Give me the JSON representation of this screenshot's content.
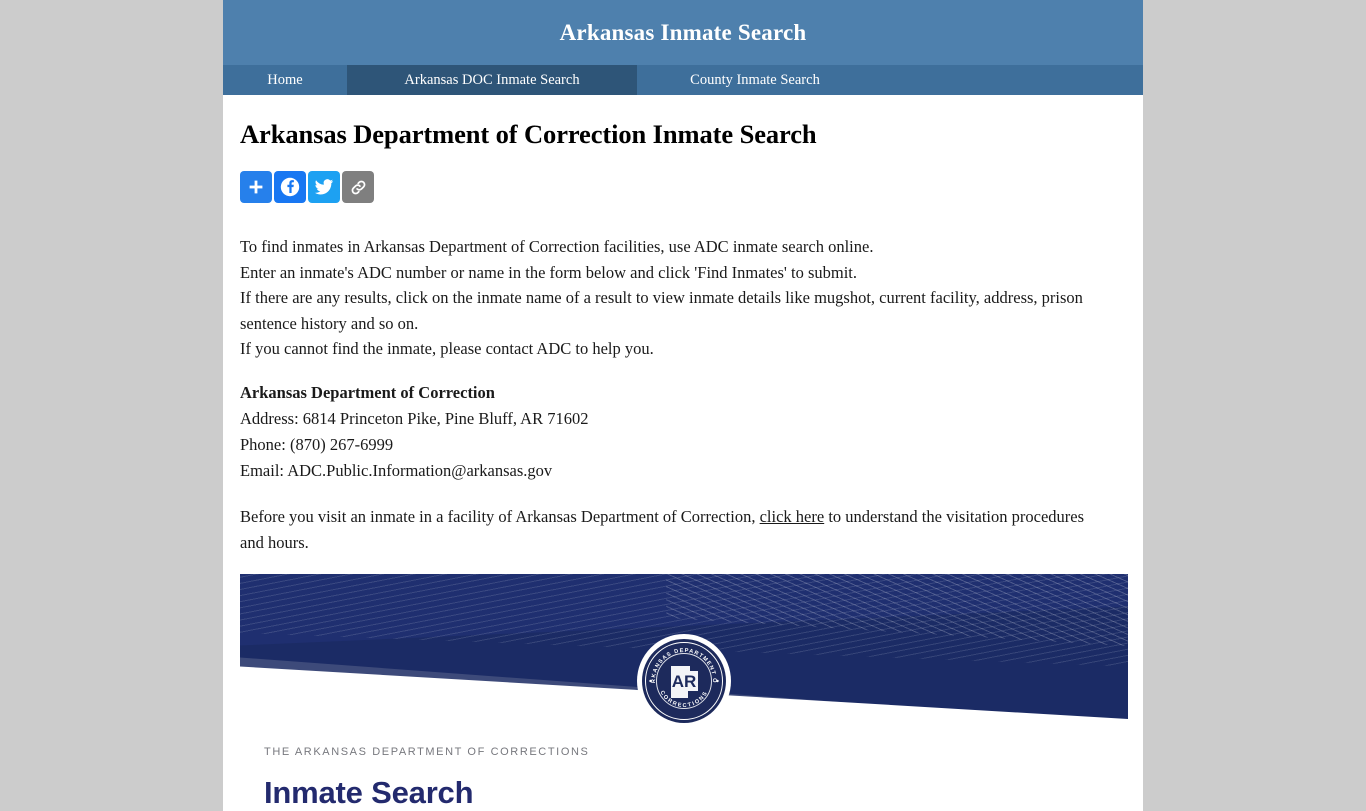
{
  "header": {
    "title": "Arkansas Inmate Search"
  },
  "nav": {
    "items": [
      {
        "label": "Home",
        "active": false
      },
      {
        "label": "Arkansas DOC Inmate Search",
        "active": true
      },
      {
        "label": "County Inmate Search",
        "active": false
      }
    ]
  },
  "main": {
    "page_title": "Arkansas Department of Correction Inmate Search",
    "share": {
      "buttons": [
        {
          "name": "share-plus-icon",
          "label": "Share",
          "color": "#2680eb"
        },
        {
          "name": "facebook-icon",
          "label": "Facebook",
          "color": "#1877f2"
        },
        {
          "name": "twitter-icon",
          "label": "Twitter",
          "color": "#1da1f2"
        },
        {
          "name": "copy-link-icon",
          "label": "Copy Link",
          "color": "#7f7f7f"
        }
      ]
    },
    "intro": {
      "line1": "To find inmates in Arkansas Department of Correction facilities, use ADC inmate search online.",
      "line2": "Enter an inmate's ADC number or name in the form below and click 'Find Inmates' to submit.",
      "line3": "If there are any results, click on the inmate name of a result to view inmate details like mugshot, current facility, address, prison sentence history and so on.",
      "line4": "If you cannot find the inmate, please contact ADC to help you."
    },
    "contact": {
      "org": "Arkansas Department of Correction",
      "address": "Address: 6814 Princeton Pike, Pine Bluff, AR 71602",
      "phone": "Phone: (870) 267-6999",
      "email": "Email: ADC.Public.Information@arkansas.gov"
    },
    "visitation": {
      "before_link": "Before you visit an inmate in a facility of Arkansas Department of Correction, ",
      "link_text": "click here",
      "after_link": " to understand the visitation procedures and hours."
    }
  },
  "adc_embed": {
    "seal": {
      "top_text": "ARKANSAS DEPARTMENT OF",
      "bottom_text": "CORRECTIONS",
      "monogram": "AR"
    },
    "eyebrow": "THE ARKANSAS DEPARTMENT OF CORRECTIONS",
    "heading": "Inmate Search"
  },
  "colors": {
    "header_blue": "#4e80ad",
    "nav_blue": "#3e6f9b",
    "nav_active_blue": "#2e5578",
    "page_background": "#cccccc",
    "banner_navy": "#1f2f70",
    "heading_navy": "#232a6e"
  }
}
